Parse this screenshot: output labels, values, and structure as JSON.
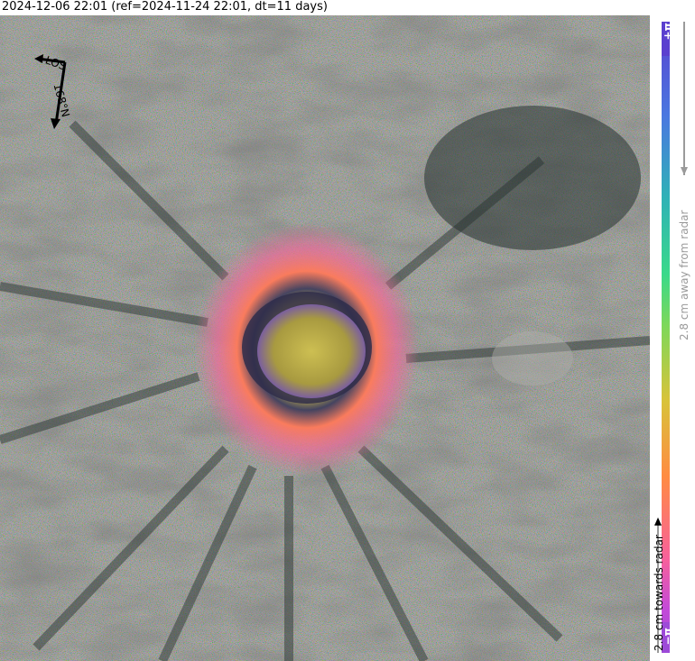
{
  "header": {
    "title": "2024-12-06 22:01 (ref=2024-11-24 22:01, dt=11 days)"
  },
  "compass": {
    "los_label": "LOS",
    "heading_label": "168°N"
  },
  "colorbar": {
    "top_label": "+π",
    "bottom_label": "−π",
    "away_label": "2.8 cm away from radar",
    "towards_label": "2.8 cm towards radar"
  },
  "colors": {
    "title_text": "#000000",
    "away_text": "#9a9a9a",
    "towards_text": "#000000",
    "crater_core": "#b8b04a",
    "crater_rim": "#ff7a5a"
  }
}
